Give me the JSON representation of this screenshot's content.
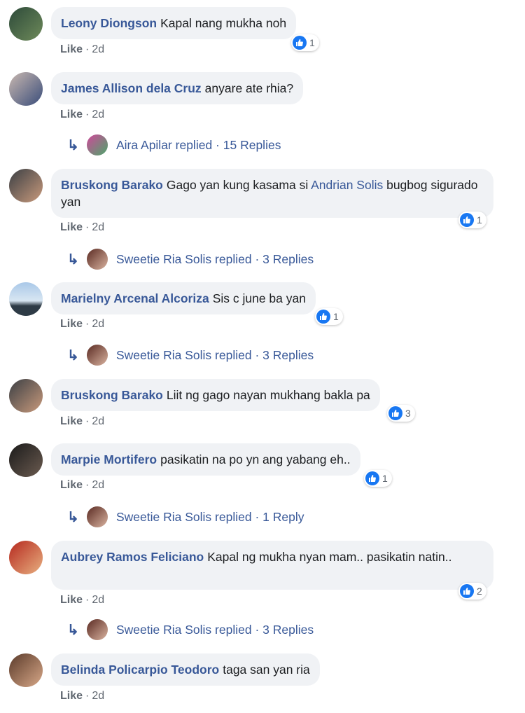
{
  "comments": [
    {
      "author": "Leony Diongson",
      "text": "Kapal nang mukha noh",
      "like": "Like",
      "time": "2d",
      "reactions": "1",
      "avatar_colors": [
        "#2d4a3a",
        "#6e8a5a"
      ]
    },
    {
      "author": "James Allison dela Cruz",
      "text": "anyare ate rhia?",
      "like": "Like",
      "time": "2d",
      "avatar_colors": [
        "#c9b8b0",
        "#3a4d7a"
      ],
      "reply": {
        "name": "Aira Apilar",
        "verb": "replied",
        "count": "15 Replies",
        "avatar_colors": [
          "#d0489a",
          "#4ca66a"
        ]
      }
    },
    {
      "author": "Bruskong Barako",
      "text_before": "Gago yan kung kasama si ",
      "mention": "Andrian Solis",
      "text_after": " bugbog sigurado yan",
      "like": "Like",
      "time": "2d",
      "reactions": "1",
      "avatar_colors": [
        "#3b3f44",
        "#c99a7c"
      ],
      "reply": {
        "name": "Sweetie Ria Solis",
        "verb": "replied",
        "count": "3 Replies",
        "avatar_colors": [
          "#5a2a22",
          "#d9b3a0"
        ]
      }
    },
    {
      "author": "Marielny Arcenal Alcoriza",
      "text": "Sis c june ba yan",
      "like": "Like",
      "time": "2d",
      "reactions": "1",
      "avatar_colors": [
        "#a9c8e8",
        "#2e3b46"
      ],
      "reply": {
        "name": "Sweetie Ria Solis",
        "verb": "replied",
        "count": "3 Replies",
        "avatar_colors": [
          "#5a2a22",
          "#d9b3a0"
        ]
      }
    },
    {
      "author": "Bruskong Barako",
      "text": "Liit ng gago nayan mukhang bakla pa",
      "like": "Like",
      "time": "2d",
      "reactions": "3",
      "avatar_colors": [
        "#3b3f44",
        "#c99a7c"
      ]
    },
    {
      "author": "Marpie Mortifero",
      "text": "pasikatin na po yn ang yabang eh..",
      "like": "Like",
      "time": "2d",
      "reactions": "1",
      "avatar_colors": [
        "#1a1a1a",
        "#6b5b50"
      ],
      "reply": {
        "name": "Sweetie Ria Solis",
        "verb": "replied",
        "count": "1 Reply",
        "avatar_colors": [
          "#5a2a22",
          "#d9b3a0"
        ]
      }
    },
    {
      "author": "Aubrey Ramos Feliciano",
      "text": "Kapal ng mukha nyan mam.. pasikatin natin..",
      "like": "Like",
      "time": "2d",
      "reactions": "2",
      "avatar_colors": [
        "#b5281e",
        "#e8b080"
      ],
      "reply": {
        "name": "Sweetie Ria Solis",
        "verb": "replied",
        "count": "3 Replies",
        "avatar_colors": [
          "#5a2a22",
          "#d9b3a0"
        ]
      }
    },
    {
      "author": "Belinda Policarpio Teodoro",
      "text": "taga san yan ria",
      "like": "Like",
      "time": "2d",
      "avatar_colors": [
        "#5a3a2a",
        "#d8a888"
      ]
    }
  ],
  "colors": {
    "link": "#385898",
    "bubble": "#f0f2f5",
    "meta": "#606770",
    "like_blue": "#1877f2"
  },
  "icons": {
    "reaction": "thumbs-up-icon",
    "reply": "reply-arrow-icon"
  }
}
